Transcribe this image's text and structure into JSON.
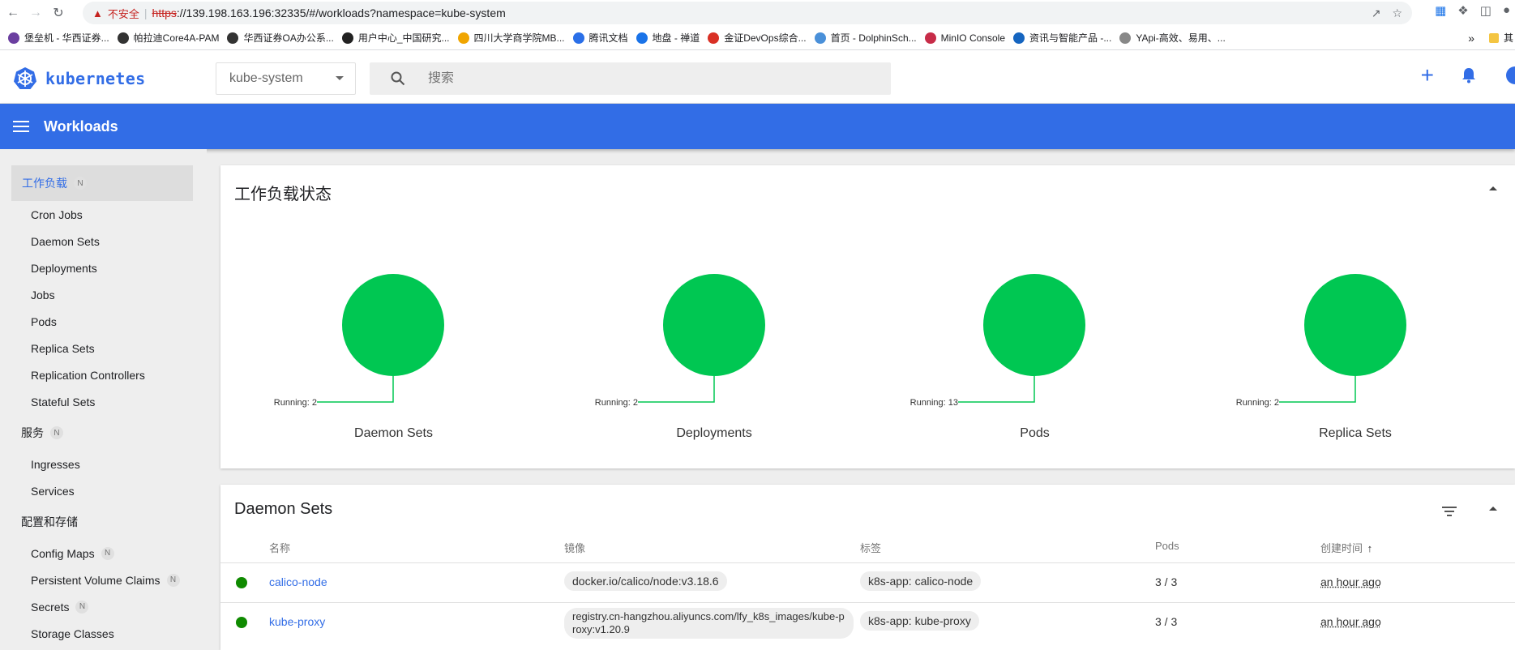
{
  "browser": {
    "insecure_label": "不安全",
    "url_scheme": "https",
    "url_rest": "://139.198.163.196:32335/#/workloads?namespace=kube-system",
    "bookmarks": [
      {
        "label": "堡垒机 - 华西证券...",
        "color": "#6b3fa0"
      },
      {
        "label": "帕拉迪Core4A-PAM",
        "color": "#333333"
      },
      {
        "label": "华西证券OA办公系...",
        "color": "#333333"
      },
      {
        "label": "用户中心_中国研究...",
        "color": "#222222"
      },
      {
        "label": "四川大学商学院MB...",
        "color": "#f0a500"
      },
      {
        "label": "腾讯文档",
        "color": "#2a6fe8"
      },
      {
        "label": "地盘 - 禅道",
        "color": "#1a73e8"
      },
      {
        "label": "金证DevOps综合...",
        "color": "#d93025"
      },
      {
        "label": "首页 - DolphinSch...",
        "color": "#4a90d9"
      },
      {
        "label": "MinIO Console",
        "color": "#c72c48"
      },
      {
        "label": "资讯与智能产品 -...",
        "color": "#1565c0"
      },
      {
        "label": "YApi-高效、易用、...",
        "color": "#888888"
      }
    ],
    "bookmarks_more": "»",
    "bookmarks_other": "其"
  },
  "header": {
    "brand": "kubernetes",
    "namespace": "kube-system",
    "search_placeholder": "搜索"
  },
  "toolbar": {
    "title": "Workloads"
  },
  "sidebar": {
    "section_workloads": "工作负载",
    "section_workloads_badge": "N",
    "workload_items": [
      "Cron Jobs",
      "Daemon Sets",
      "Deployments",
      "Jobs",
      "Pods",
      "Replica Sets",
      "Replication Controllers",
      "Stateful Sets"
    ],
    "section_services": "服务",
    "section_services_badge": "N",
    "service_items": [
      "Ingresses",
      "Services"
    ],
    "section_config": "配置和存储",
    "config_items": [
      {
        "label": "Config Maps",
        "badge": "N"
      },
      {
        "label": "Persistent Volume Claims",
        "badge": "N"
      },
      {
        "label": "Secrets",
        "badge": "N"
      },
      {
        "label": "Storage Classes",
        "badge": ""
      }
    ]
  },
  "status_card": {
    "title": "工作负载状态",
    "charts": [
      {
        "name": "Daemon Sets",
        "running_label": "Running: 2",
        "running": 2,
        "failed": 0,
        "pending": 0
      },
      {
        "name": "Deployments",
        "running_label": "Running: 2",
        "running": 2,
        "failed": 0,
        "pending": 0
      },
      {
        "name": "Pods",
        "running_label": "Running: 13",
        "running": 13,
        "failed": 0,
        "pending": 0
      },
      {
        "name": "Replica Sets",
        "running_label": "Running: 2",
        "running": 2,
        "failed": 0,
        "pending": 0
      }
    ],
    "running_color": "#00c752"
  },
  "daemonsets_card": {
    "title": "Daemon Sets",
    "columns": [
      "名称",
      "镜像",
      "标签",
      "Pods",
      "创建时间"
    ],
    "sort_indicator": "↑",
    "rows": [
      {
        "name": "calico-node",
        "image": "docker.io/calico/node:v3.18.6",
        "label": "k8s-app: calico-node",
        "pods": "3 / 3",
        "created": "an hour ago"
      },
      {
        "name": "kube-proxy",
        "image": "registry.cn-hangzhou.aliyuncs.com/lfy_k8s_images/kube-proxy:v1.20.9",
        "label": "k8s-app: kube-proxy",
        "pods": "3 / 3",
        "created": "an hour ago"
      }
    ]
  },
  "colors": {
    "brand": "#326de6",
    "status_ok": "#0f8a00"
  }
}
